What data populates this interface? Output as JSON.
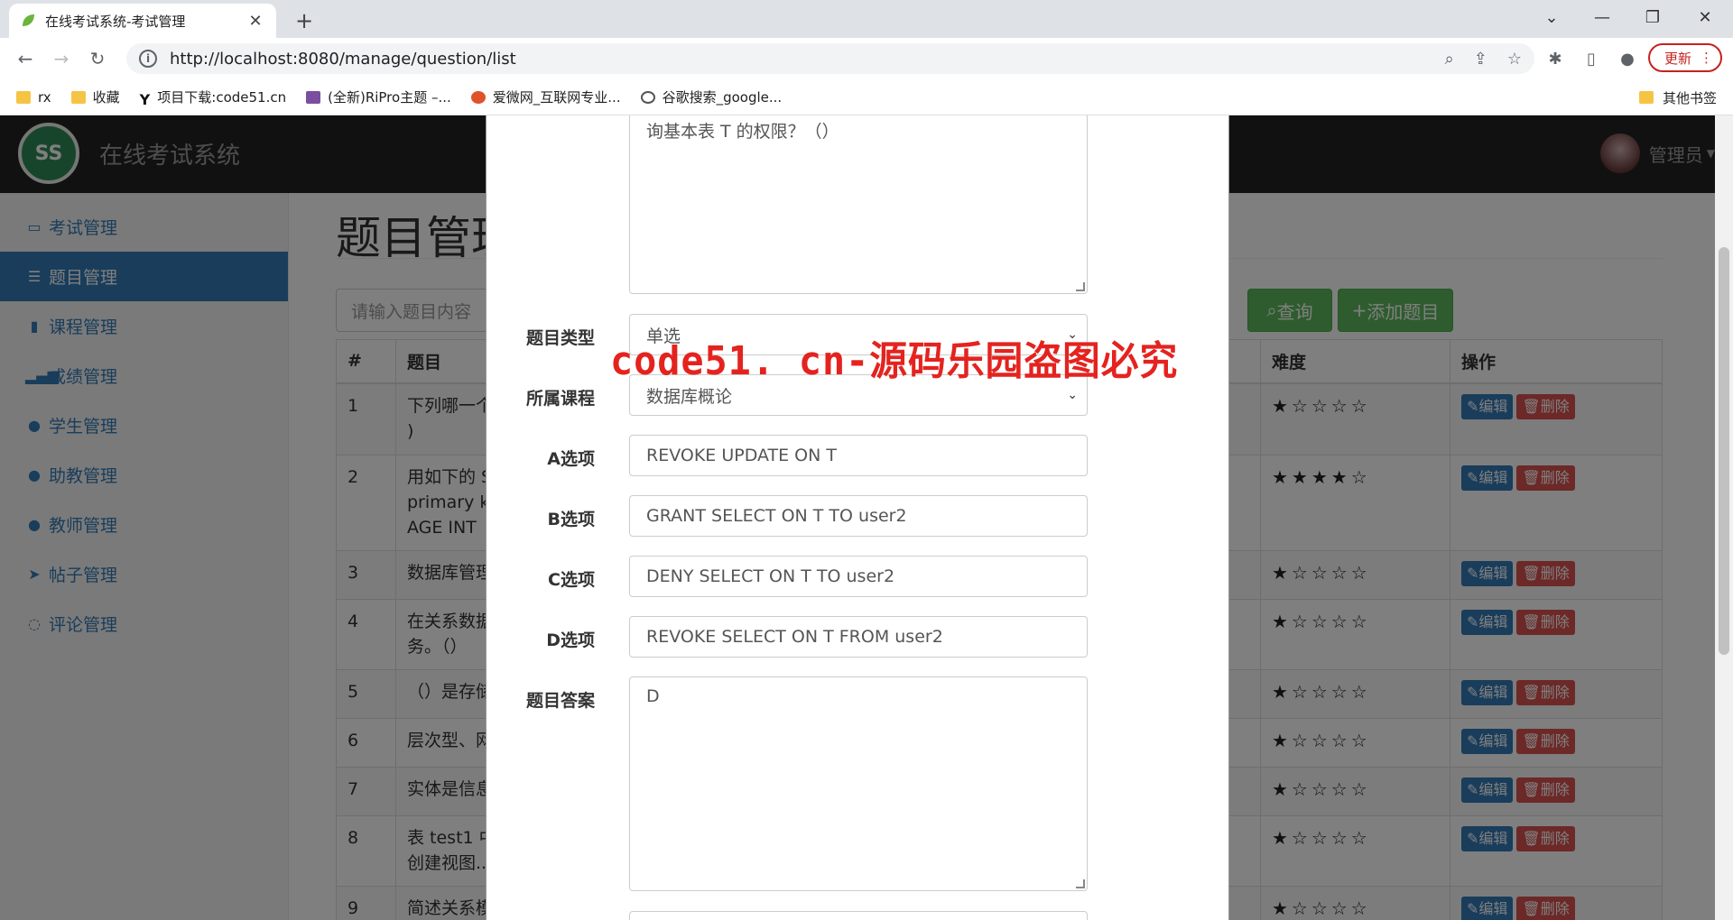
{
  "browser": {
    "tab_title": "在线考试系统-考试管理",
    "url": "http://localhost:8080/manage/question/list",
    "update_label": "更新",
    "bookmarks": [
      "rx",
      "收藏",
      "项目下载:code51.cn",
      "(全新)RiPro主题 –...",
      "爱微网_互联网专业...",
      "谷歌搜索_google..."
    ],
    "other_bookmarks": "其他书签"
  },
  "app": {
    "brand": "在线考试系统",
    "user": "管理员"
  },
  "sidebar": {
    "items": [
      {
        "label": "考试管理",
        "icon": "monitor-icon"
      },
      {
        "label": "题目管理",
        "icon": "list-icon"
      },
      {
        "label": "课程管理",
        "icon": "book-icon"
      },
      {
        "label": "成绩管理",
        "icon": "bar-chart-icon"
      },
      {
        "label": "学生管理",
        "icon": "user-icon"
      },
      {
        "label": "助教管理",
        "icon": "user-icon"
      },
      {
        "label": "教师管理",
        "icon": "user-icon"
      },
      {
        "label": "帖子管理",
        "icon": "send-icon"
      },
      {
        "label": "评论管理",
        "icon": "comment-icon"
      }
    ]
  },
  "main": {
    "title": "题目管理",
    "search_placeholder": "请输入题目内容",
    "query_label": "查询",
    "add_label": "添加题目",
    "headers": {
      "num": "#",
      "question": "题目",
      "difficulty": "难度",
      "actions": "操作"
    },
    "edit_label": "编辑",
    "delete_label": "删除",
    "rows": [
      {
        "num": "1",
        "q1": "下列哪一个",
        "q2": ")",
        "q3": "",
        "stars": "★☆☆☆☆"
      },
      {
        "num": "2",
        "q1": "用如下的 S",
        "q2": "primary ke",
        "q3": "AGE  INT",
        "stars": "★★★★☆"
      },
      {
        "num": "3",
        "q1": "数据库管理",
        "q2": "",
        "q3": "",
        "stars": "★☆☆☆☆"
      },
      {
        "num": "4",
        "q1": "在关系数据",
        "q2": "务。（）",
        "q3": "",
        "stars": "★☆☆☆☆"
      },
      {
        "num": "5",
        "q1": "（）是存储",
        "q2": "",
        "q3": "",
        "stars": "★☆☆☆☆"
      },
      {
        "num": "6",
        "q1": "层次型、网",
        "q2": "",
        "q3": "",
        "stars": "★☆☆☆☆"
      },
      {
        "num": "7",
        "q1": "实体是信息",
        "q2": "",
        "q3": "",
        "stars": "★☆☆☆☆"
      },
      {
        "num": "8",
        "q1": "表 test1 中",
        "q2": "创建视图...",
        "q3": "",
        "stars": "★☆☆☆☆"
      },
      {
        "num": "9",
        "q1": "简述关系模",
        "q2": "",
        "q3": "",
        "stars": "★☆☆☆☆"
      }
    ]
  },
  "modal": {
    "content_tail": "询基本表 T 的权限？（）",
    "type_label": "题目类型",
    "type_value": "单选",
    "course_label": "所属课程",
    "course_value": "数据库概论",
    "a_label": "A选项",
    "a_value": "REVOKE UPDATE ON T",
    "b_label": "B选项",
    "b_value": "GRANT SELECT ON T TO user2",
    "c_label": "C选项",
    "c_value": "DENY SELECT ON T TO user2",
    "d_label": "D选项",
    "d_value": "REVOKE SELECT ON T FROM user2",
    "answer_label": "题目答案",
    "answer_value": "D"
  },
  "watermark": "code51. cn-源码乐园盗图必究",
  "colors": {
    "primary": "#337ab7",
    "success": "#5cb85c",
    "danger": "#d9534f",
    "navbar": "#222222",
    "watermark": "#e4231f"
  }
}
